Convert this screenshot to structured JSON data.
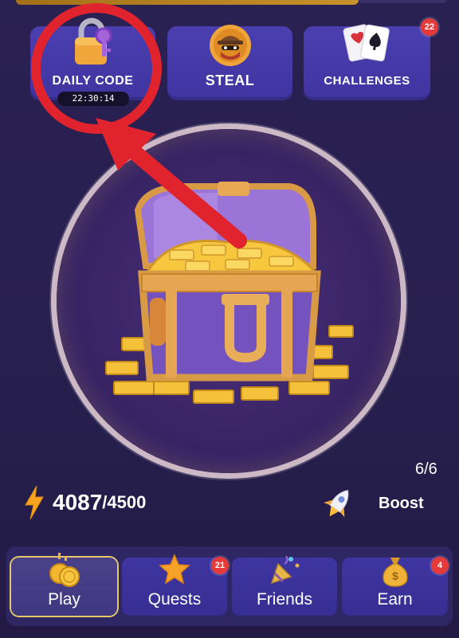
{
  "features": {
    "daily_code": {
      "label": "DAILY CODE",
      "timer": "22:30:14"
    },
    "steal": {
      "label": "STEAL"
    },
    "challenges": {
      "label": "CHALLENGES",
      "badge": "22"
    }
  },
  "energy": {
    "current": "4087",
    "max": "/4500",
    "count": "6/6"
  },
  "boost": {
    "label": "Boost"
  },
  "nav": {
    "play": {
      "label": "Play"
    },
    "quests": {
      "label": "Quests",
      "badge": "21"
    },
    "friends": {
      "label": "Friends"
    },
    "earn": {
      "label": "Earn",
      "badge": "4"
    }
  },
  "icons": {
    "daily": "padlock-key-icon",
    "steal": "thief-icon",
    "challenges": "playing-cards-icon",
    "energy": "lightning-icon",
    "boost": "rocket-icon",
    "play": "coins-icon",
    "quests": "star-icon",
    "friends": "party-horn-icon",
    "earn": "money-bag-icon",
    "chest": "treasure-chest-icon"
  },
  "colors": {
    "background": "#2a2153",
    "button": "#4339a8",
    "badge": "#e63a3a",
    "gold": "#f2b632",
    "annotation": "#e1232d"
  }
}
